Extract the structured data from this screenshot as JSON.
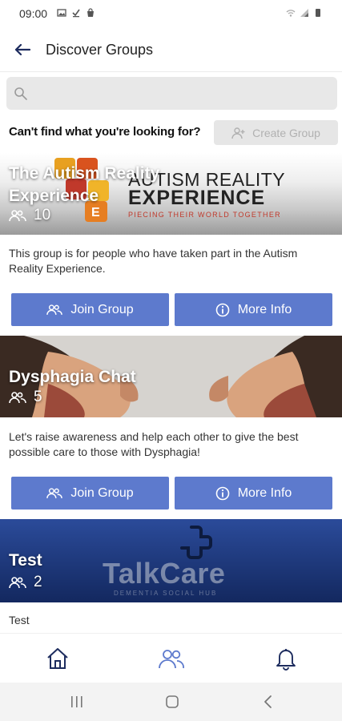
{
  "status_bar": {
    "time": "09:00"
  },
  "header": {
    "title": "Discover Groups"
  },
  "search": {
    "placeholder": "",
    "value": ""
  },
  "create_row": {
    "prompt": "Can't find what you're looking for?",
    "button_label": "Create Group"
  },
  "groups": [
    {
      "title_line1": "The Autism Reality",
      "title_line2": "Experience",
      "member_count": "10",
      "banner_logo_line1": "AUTISM REALITY",
      "banner_logo_line2": "EXPERIENCE",
      "banner_tagline": "PIECING THEIR WORLD TOGETHER",
      "description": "This group is for people who have taken part in the Autism Reality Experience.",
      "join_label": "Join Group",
      "info_label": "More Info"
    },
    {
      "title_line1": "Dysphagia Chat",
      "member_count": "5",
      "description": "Let's raise awareness and help each other to give the best possible care to those with Dysphagia!",
      "join_label": "Join Group",
      "info_label": "More Info"
    },
    {
      "title_line1": "Test",
      "member_count": "2",
      "banner_brand": "TalkCare",
      "banner_brand_sub": "DEMENTIA SOCIAL HUB",
      "description": "Test"
    }
  ],
  "bottom_nav": [
    {
      "name": "home",
      "icon": "home-icon"
    },
    {
      "name": "groups",
      "icon": "groups-icon",
      "active": true
    },
    {
      "name": "notifications",
      "icon": "bell-icon"
    }
  ],
  "colors": {
    "accent": "#5d7acd",
    "active_nav": "#5d7acd",
    "dark_navy": "#1d2c5e"
  }
}
